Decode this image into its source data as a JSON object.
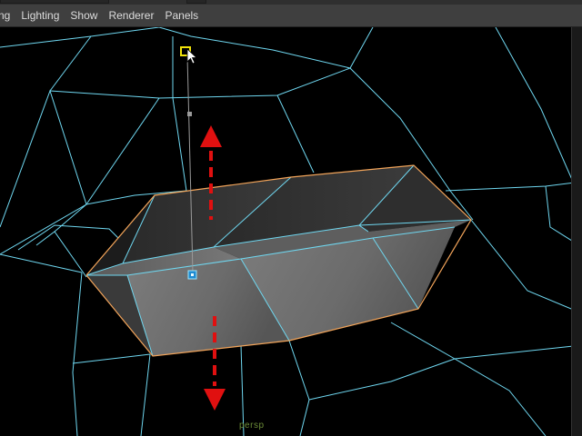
{
  "menu": {
    "items": [
      {
        "label": "ng"
      },
      {
        "label": "Lighting"
      },
      {
        "label": "Show"
      },
      {
        "label": "Renderer"
      },
      {
        "label": "Panels"
      }
    ]
  },
  "viewport": {
    "camera_label": "persp",
    "wire_color": "#6fd7f0",
    "selection_color": "#f2a45a",
    "manipulator_color": "#f2e40a",
    "arrow_color": "#e01010"
  }
}
